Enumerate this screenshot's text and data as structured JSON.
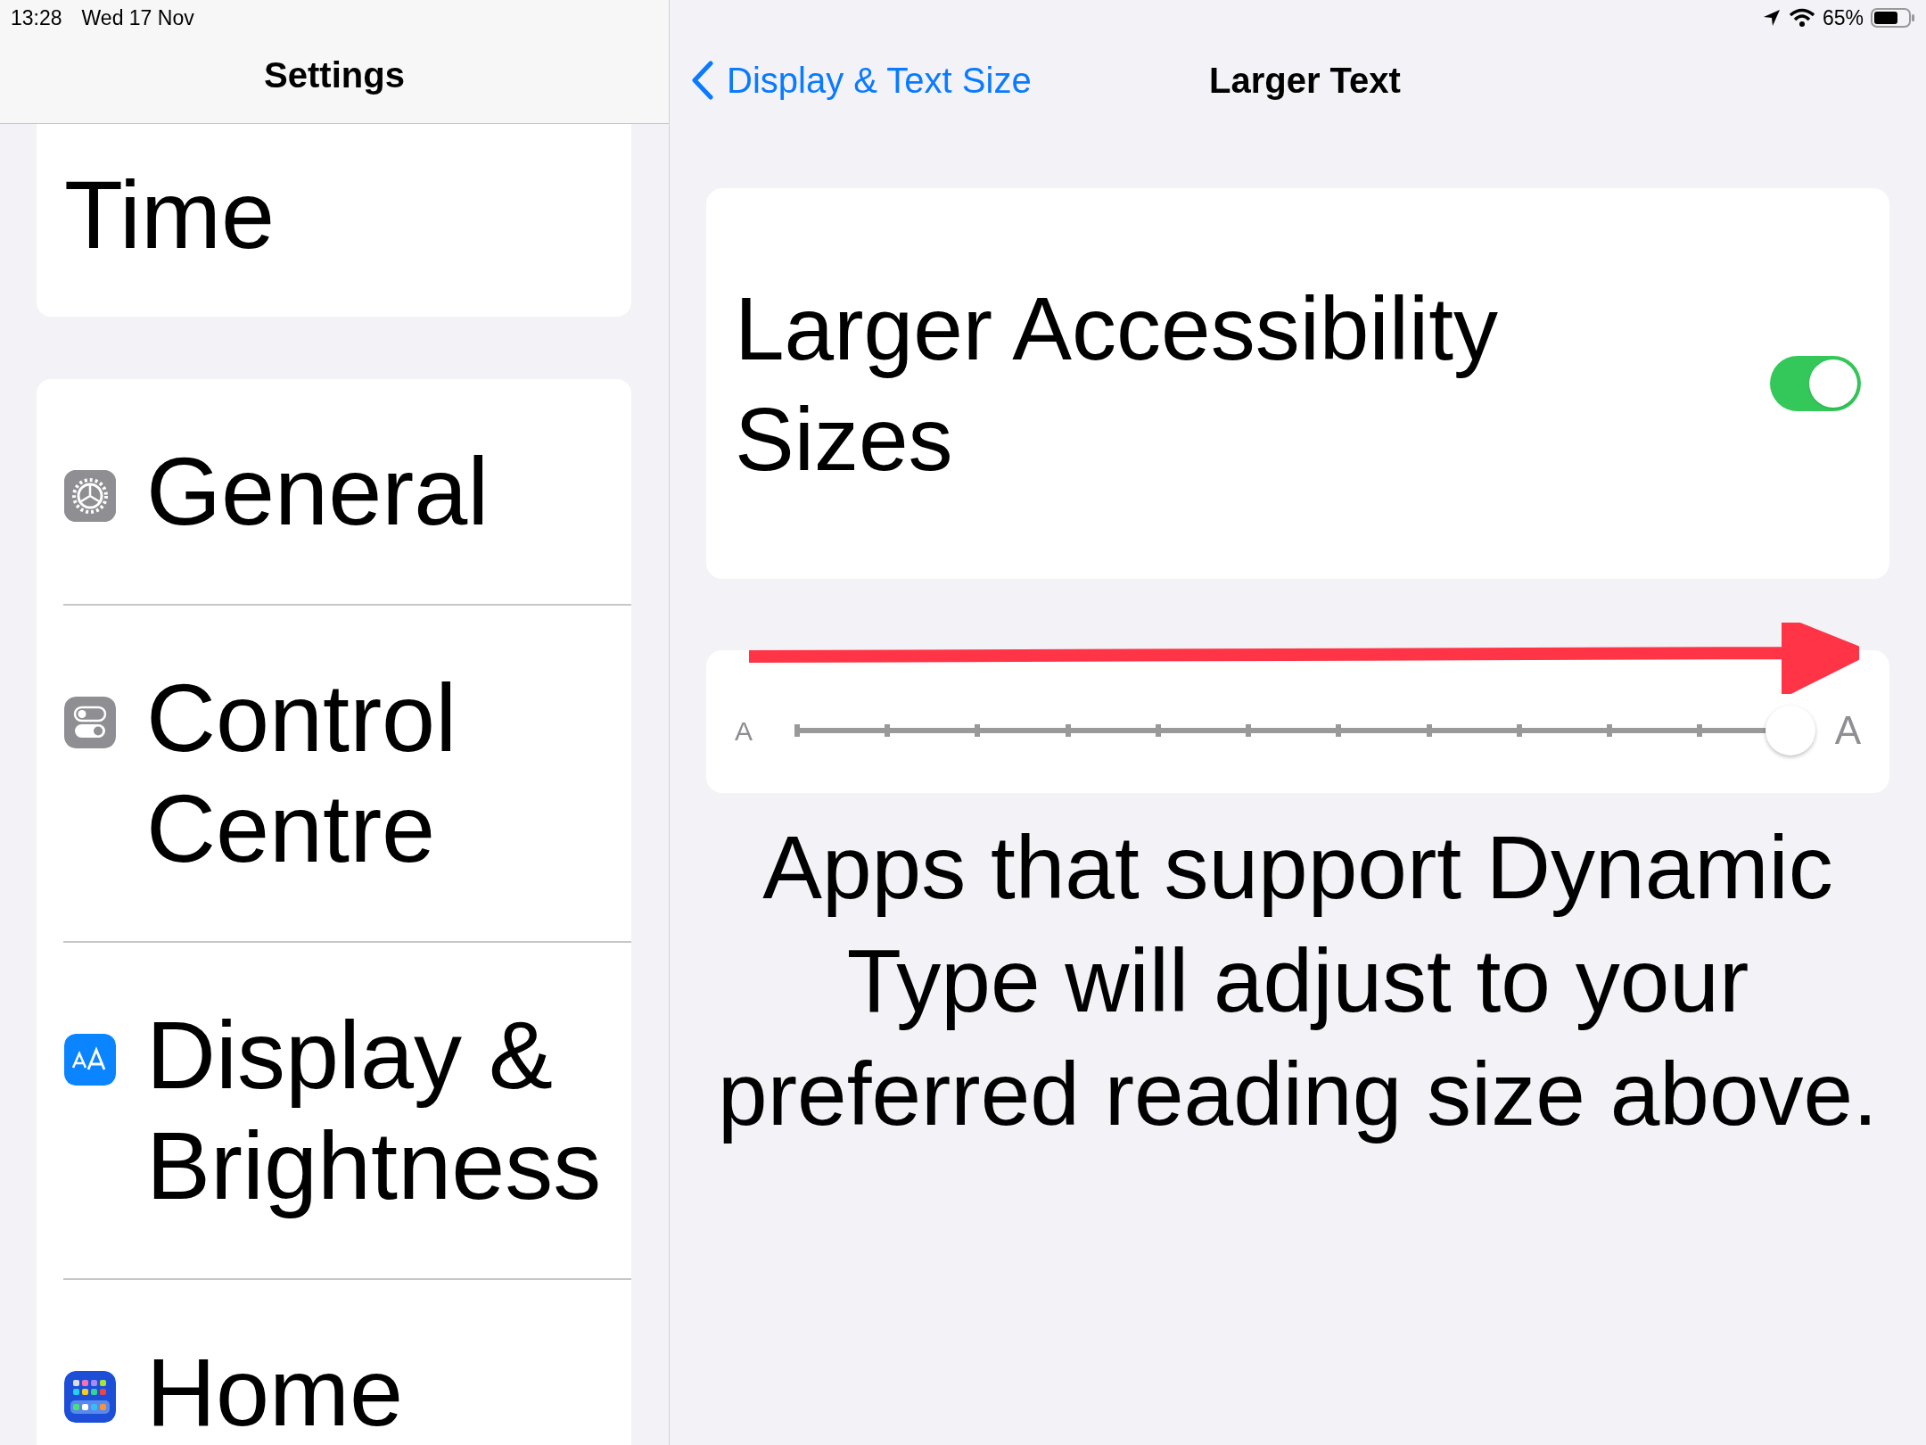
{
  "status_bar": {
    "time": "13:28",
    "date": "Wed 17 Nov",
    "battery": "65%"
  },
  "sidebar": {
    "title": "Settings",
    "groups": [
      {
        "items": [
          {
            "label": "Time",
            "kind": "none"
          }
        ]
      },
      {
        "items": [
          {
            "label": "General",
            "kind": "gear"
          },
          {
            "label": "Control Centre",
            "kind": "toggles"
          },
          {
            "label": "Display & Brightness",
            "kind": "text-size"
          },
          {
            "label": "Home",
            "kind": "grid"
          }
        ]
      }
    ]
  },
  "nav": {
    "back": "Display & Text Size",
    "title": "Larger Text"
  },
  "toggle_row": {
    "label": "Larger Accessibility Sizes",
    "on": true
  },
  "slider": {
    "small_label": "A",
    "large_label": "A",
    "level": 1
  },
  "footer": "Apps that support Dynamic Type will adjust to your preferred reading size above."
}
